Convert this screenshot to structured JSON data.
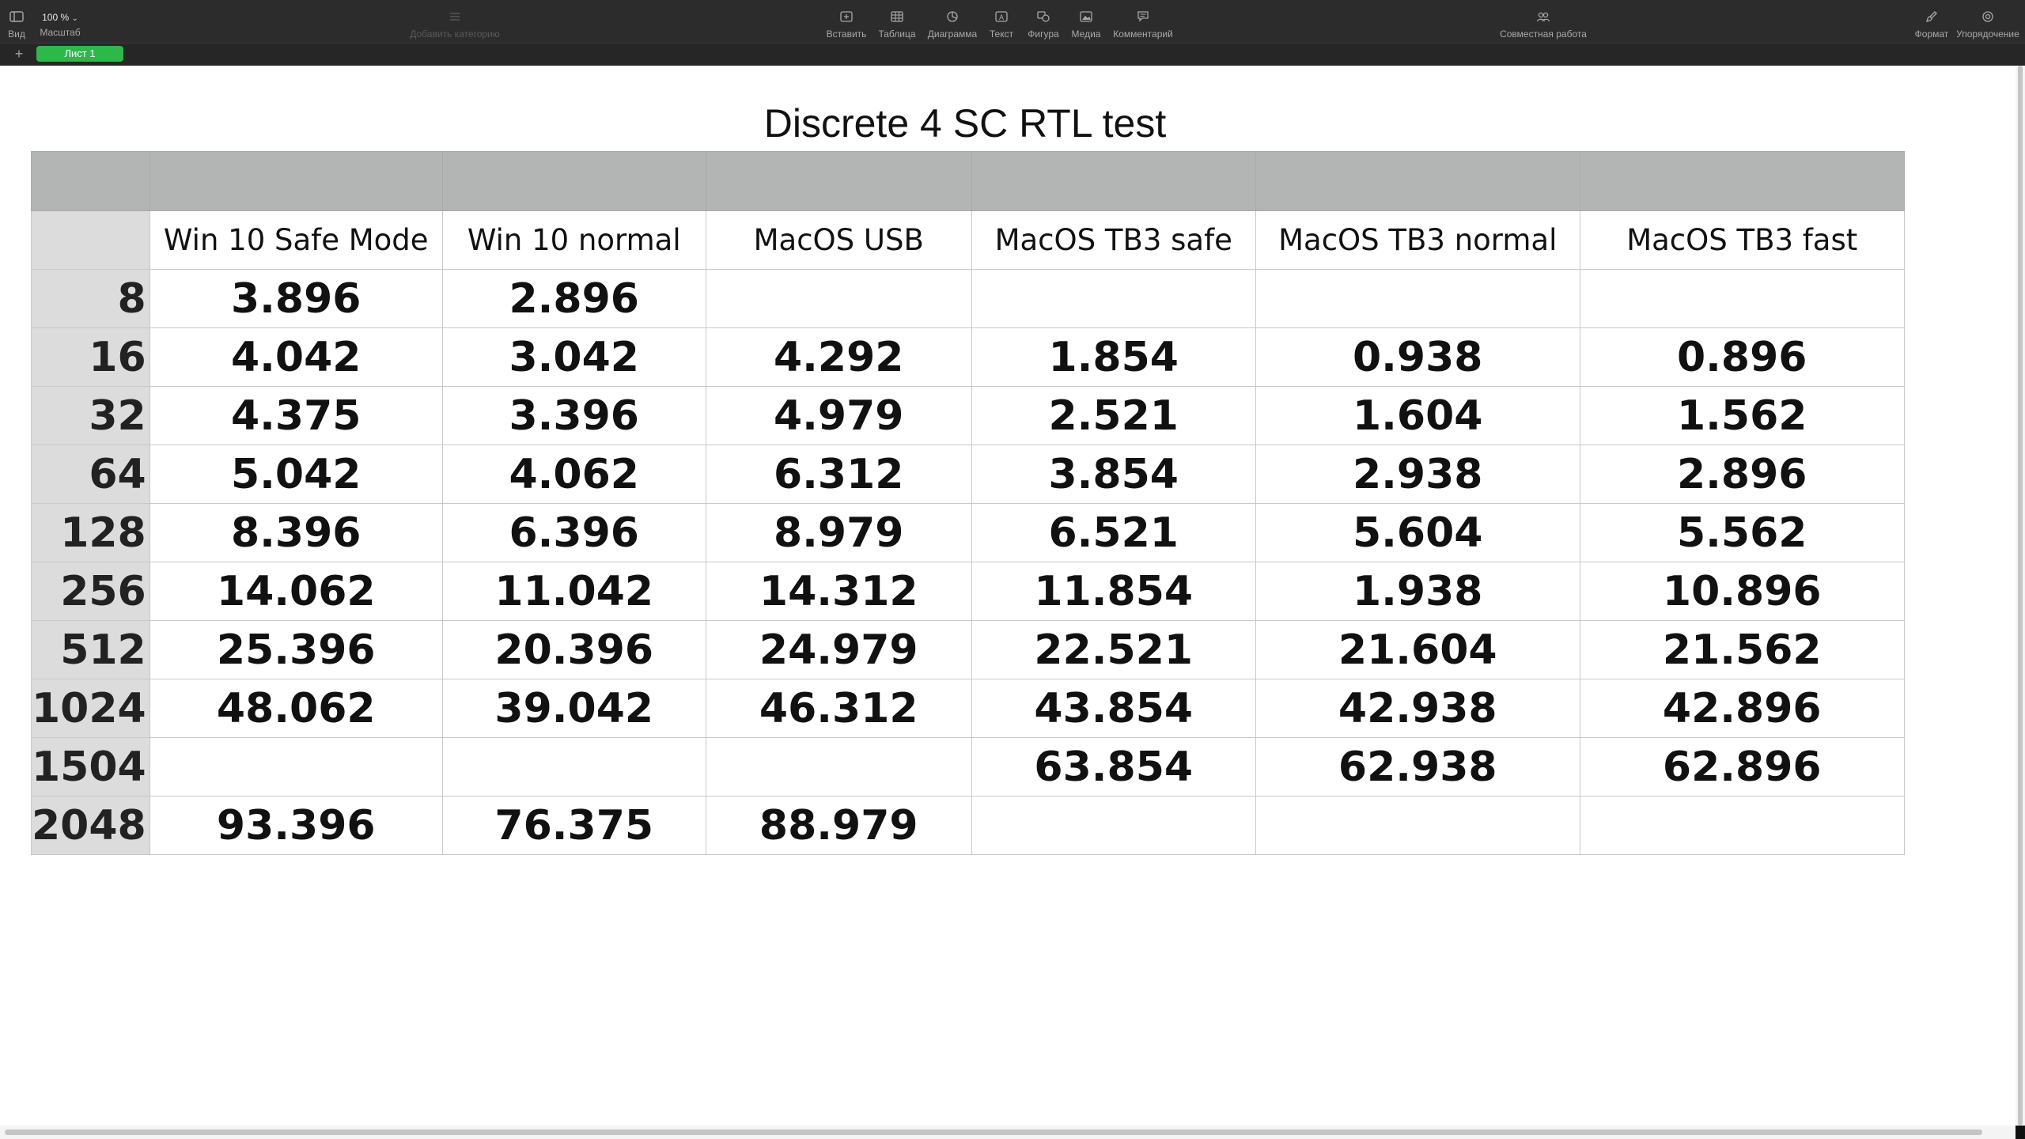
{
  "toolbar": {
    "view": {
      "label": "Вид",
      "icon": "sidebar-icon"
    },
    "zoom": {
      "value": "100 %",
      "label": "Масштаб"
    },
    "add_category": {
      "label": "Добавить категорию",
      "icon": "category-list-icon"
    },
    "insert": {
      "label": "Вставить",
      "icon": "plus-square-icon"
    },
    "table": {
      "label": "Таблица",
      "icon": "table-icon"
    },
    "chart": {
      "label": "Диаграмма",
      "icon": "chart-pie-icon"
    },
    "text": {
      "label": "Текст",
      "icon": "text-box-icon"
    },
    "shape": {
      "label": "Фигура",
      "icon": "shape-icon"
    },
    "media": {
      "label": "Медиа",
      "icon": "image-icon"
    },
    "comment": {
      "label": "Комментарий",
      "icon": "comment-icon"
    },
    "collaborate": {
      "label": "Совместная работа",
      "icon": "collaborate-icon"
    },
    "format": {
      "label": "Формат",
      "icon": "brush-icon"
    },
    "organize": {
      "label": "Упорядочение",
      "icon": "organize-icon"
    }
  },
  "sheets": {
    "add_label": "+",
    "tabs": [
      {
        "label": "Лист 1"
      }
    ]
  },
  "sheet_title": "Discrete 4 SC RTL test",
  "table": {
    "columns": [
      "Win 10 Safe Mode",
      "Win 10 normal",
      "MacOS USB",
      "MacOS TB3 safe",
      "MacOS TB3 normal",
      "MacOS TB3 fast"
    ],
    "rows": [
      {
        "label": "8",
        "cells": [
          "3.896",
          "2.896",
          "",
          "",
          "",
          ""
        ]
      },
      {
        "label": "16",
        "cells": [
          "4.042",
          "3.042",
          "4.292",
          "1.854",
          "0.938",
          "0.896"
        ]
      },
      {
        "label": "32",
        "cells": [
          "4.375",
          "3.396",
          "4.979",
          "2.521",
          "1.604",
          "1.562"
        ]
      },
      {
        "label": "64",
        "cells": [
          "5.042",
          "4.062",
          "6.312",
          "3.854",
          "2.938",
          "2.896"
        ]
      },
      {
        "label": "128",
        "cells": [
          "8.396",
          "6.396",
          "8.979",
          "6.521",
          "5.604",
          "5.562"
        ]
      },
      {
        "label": "256",
        "cells": [
          "14.062",
          "11.042",
          "14.312",
          "11.854",
          "1.938",
          "10.896"
        ]
      },
      {
        "label": "512",
        "cells": [
          "25.396",
          "20.396",
          "24.979",
          "22.521",
          "21.604",
          "21.562"
        ]
      },
      {
        "label": "1024",
        "cells": [
          "48.062",
          "39.042",
          "46.312",
          "43.854",
          "42.938",
          "42.896"
        ]
      },
      {
        "label": "1504",
        "cells": [
          "",
          "",
          "",
          "63.854",
          "62.938",
          "62.896"
        ]
      },
      {
        "label": "2048",
        "cells": [
          "93.396",
          "76.375",
          "88.979",
          "",
          "",
          ""
        ]
      }
    ]
  },
  "colors": {
    "toolbar_bg": "#2c2c2c",
    "sheet_tab_active": "#2db84a",
    "header_band": "#b3b5b4",
    "row_header_bg": "#dcdcdc"
  }
}
